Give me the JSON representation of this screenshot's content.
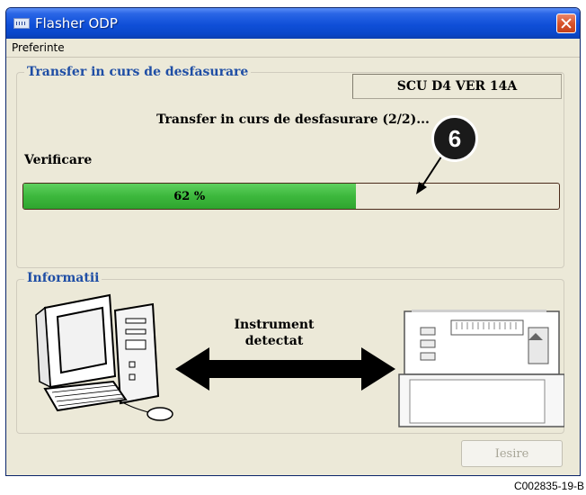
{
  "window": {
    "title": "Flasher ODP"
  },
  "menu": {
    "items": [
      "Preferinte"
    ]
  },
  "transfer_group": {
    "legend": "Transfer in curs de desfasurare",
    "version": "SCU D4 VER 14A",
    "status": "Transfer in curs de desfasurare (2/2)...",
    "verification_label": "Verificare",
    "progress": {
      "value": 62,
      "label": "62 %",
      "fill_color": "#3db83d"
    }
  },
  "callout": {
    "number": "6"
  },
  "info_group": {
    "legend": "Informatii",
    "detect_line1": "Instrument",
    "detect_line2": "detectat"
  },
  "footer": {
    "exit_label": "Iesire"
  },
  "caption": "C002835-19-B"
}
